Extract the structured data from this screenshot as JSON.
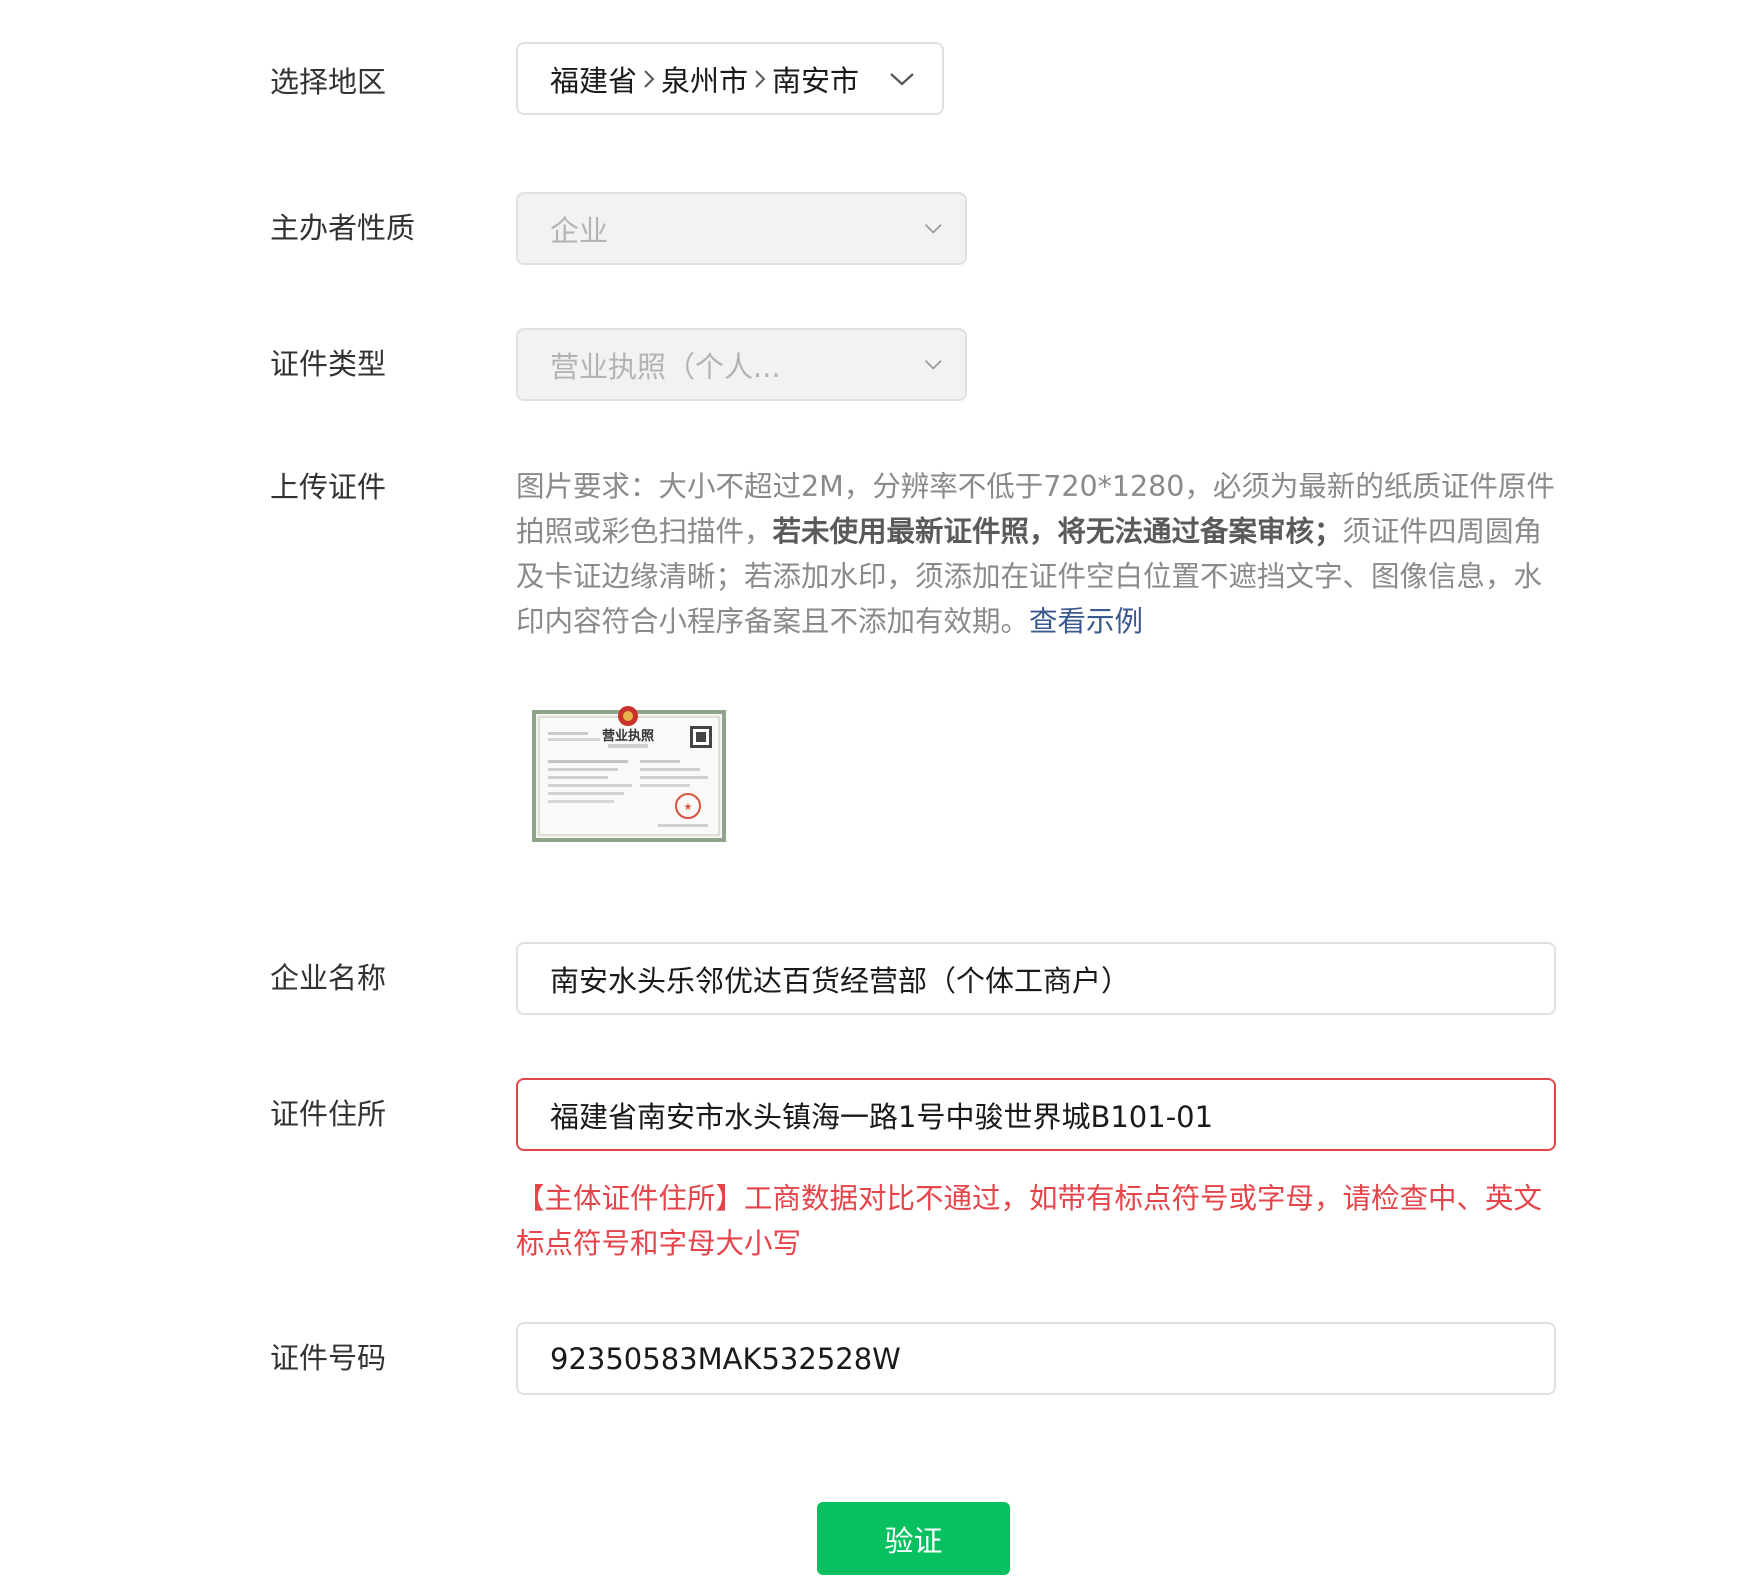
{
  "form": {
    "region": {
      "label": "选择地区",
      "province": "福建省",
      "city": "泉州市",
      "district": "南安市"
    },
    "sponsor_type": {
      "label": "主办者性质",
      "value": "企业"
    },
    "cert_type": {
      "label": "证件类型",
      "value": "营业执照（个人..."
    },
    "upload": {
      "label": "上传证件",
      "desc_part1": "图片要求：大小不超过2M，分辨率不低于720*1280，必须为最新的纸质证件原件拍照或彩色扫描件，",
      "desc_bold": "若未使用最新证件照，将无法通过备案审核；",
      "desc_part2": "须证件四周圆角及卡证边缘清晰；若添加水印，须添加在证件空白位置不遮挡文字、图像信息，水印内容符合小程序备案且不添加有效期。",
      "example_link": "查看示例",
      "thumb_title": "营业执照"
    },
    "company_name": {
      "label": "企业名称",
      "value": "南安水头乐邻优达百货经营部（个体工商户）"
    },
    "address": {
      "label": "证件住所",
      "value": "福建省南安市水头镇海一路1号中骏世界城B101-01",
      "error": "【主体证件住所】工商数据对比不通过，如带有标点符号或字母，请检查中、英文标点符号和字母大小写"
    },
    "cert_number": {
      "label": "证件号码",
      "value": "92350583MAK532528W"
    },
    "submit_label": "验证"
  },
  "colors": {
    "primary": "#07c160",
    "error": "#e5454a",
    "link": "#3a5a8f"
  }
}
